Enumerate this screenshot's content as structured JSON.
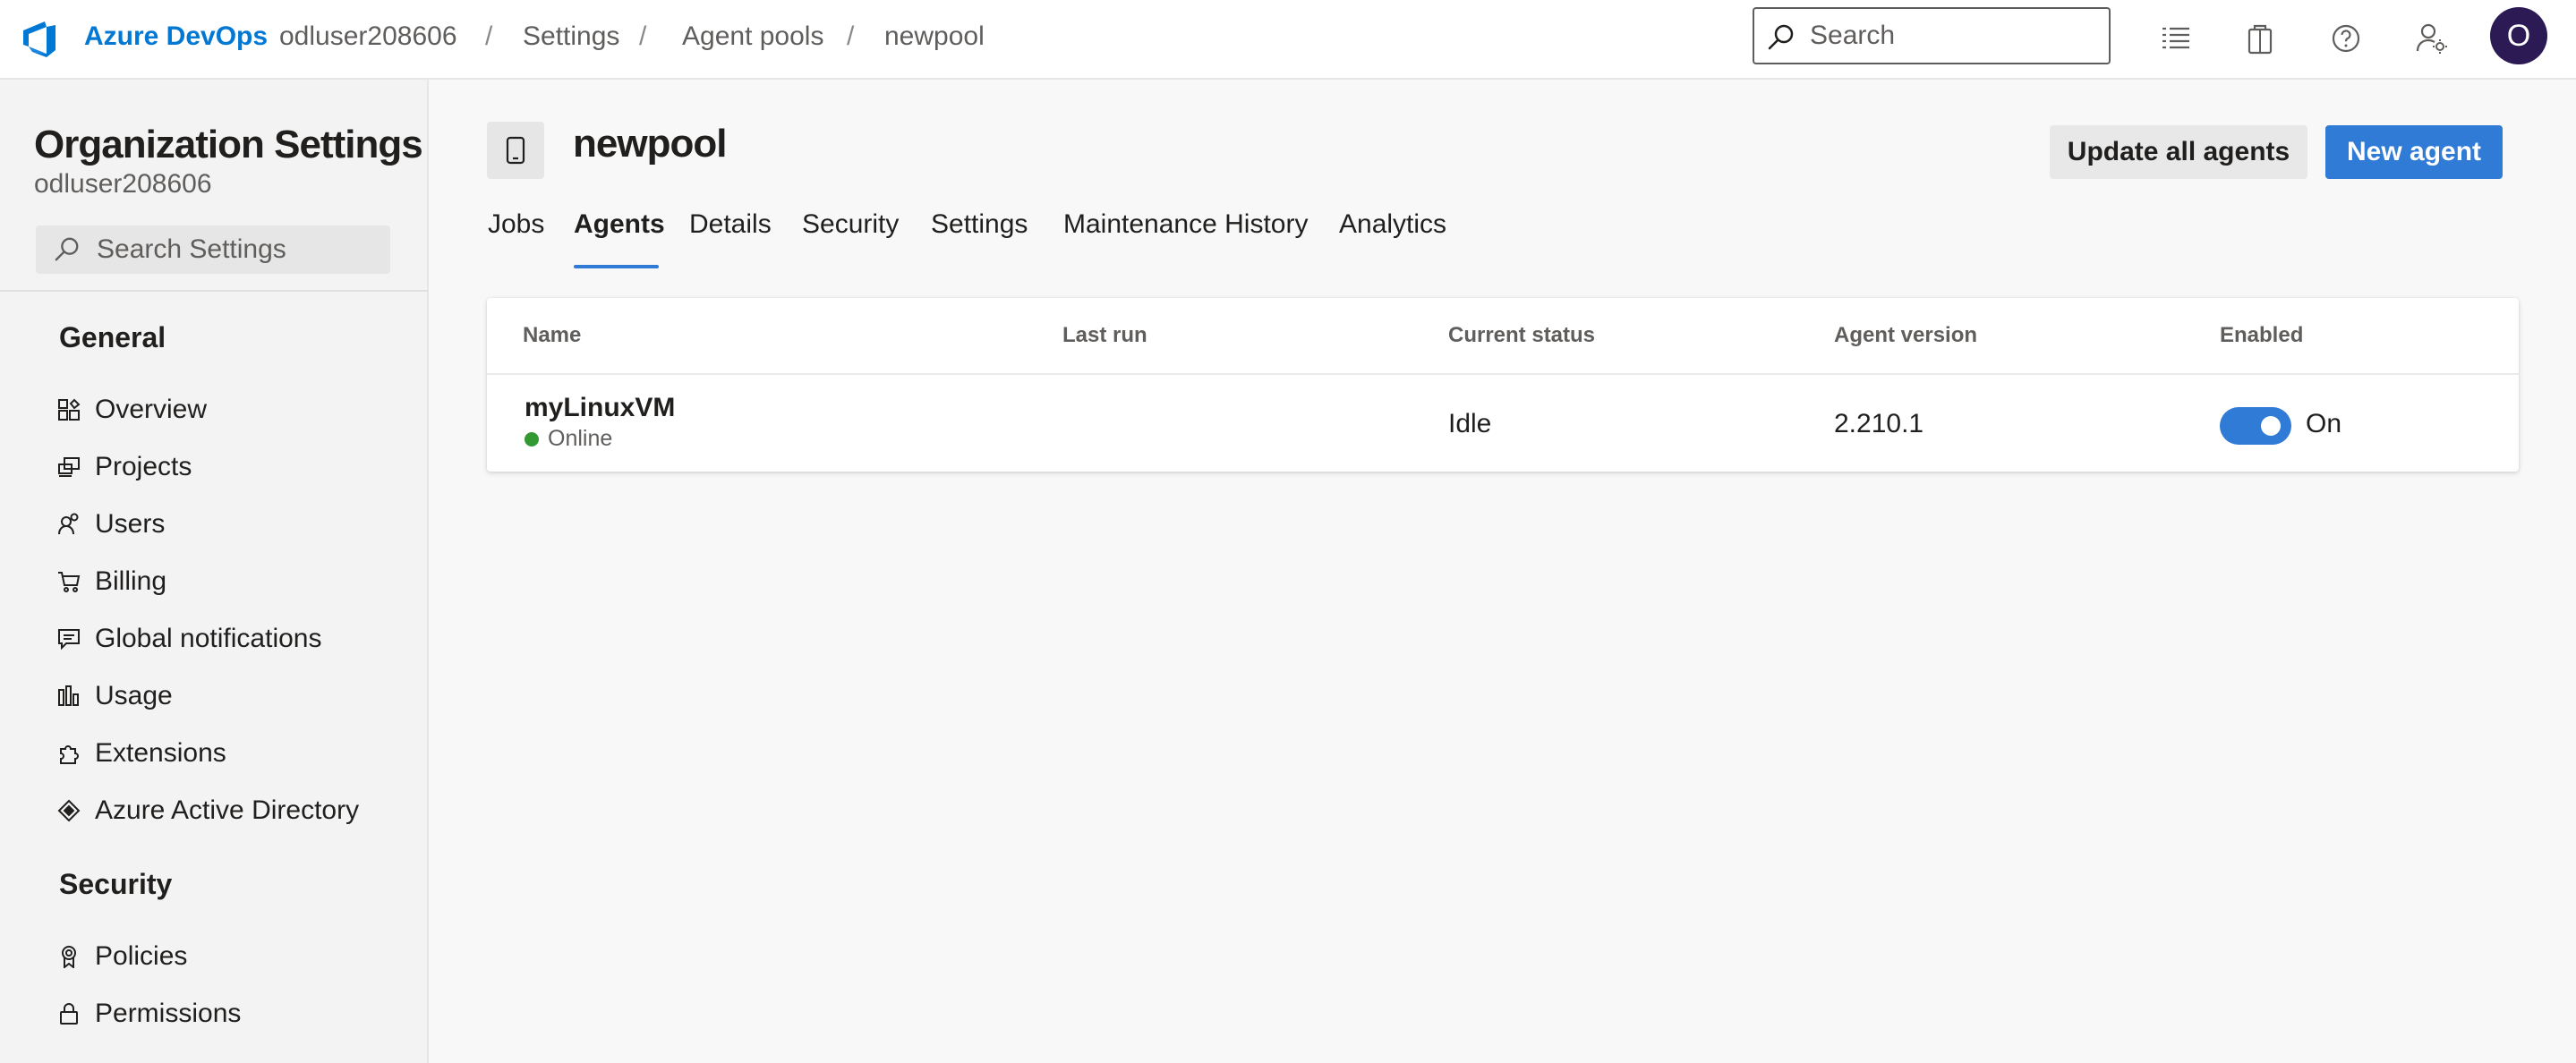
{
  "header": {
    "brand": "Azure DevOps",
    "breadcrumbs": [
      "odluser208606",
      "Settings",
      "Agent pools",
      "newpool"
    ],
    "search_placeholder": "Search",
    "avatar_initial": "O",
    "icons": [
      "task-list-icon",
      "marketplace-bag-icon",
      "help-icon",
      "user-settings-icon"
    ]
  },
  "sidebar": {
    "title": "Organization Settings",
    "subtitle": "odluser208606",
    "search_placeholder": "Search Settings",
    "sections": [
      {
        "title": "General",
        "items": [
          {
            "label": "Overview",
            "icon": "overview-icon"
          },
          {
            "label": "Projects",
            "icon": "projects-icon"
          },
          {
            "label": "Users",
            "icon": "users-icon"
          },
          {
            "label": "Billing",
            "icon": "cart-icon"
          },
          {
            "label": "Global notifications",
            "icon": "comment-icon"
          },
          {
            "label": "Usage",
            "icon": "bar-chart-icon"
          },
          {
            "label": "Extensions",
            "icon": "puzzle-icon"
          },
          {
            "label": "Azure Active Directory",
            "icon": "aad-diamond-icon"
          }
        ]
      },
      {
        "title": "Security",
        "items": [
          {
            "label": "Policies",
            "icon": "ribbon-icon"
          },
          {
            "label": "Permissions",
            "icon": "lock-icon"
          }
        ]
      }
    ]
  },
  "main": {
    "pool_name": "newpool",
    "buttons": {
      "update_all": "Update all agents",
      "new_agent": "New agent"
    },
    "tabs": [
      "Jobs",
      "Agents",
      "Details",
      "Security",
      "Settings",
      "Maintenance History",
      "Analytics"
    ],
    "active_tab": "Agents",
    "table": {
      "columns": [
        "Name",
        "Last run",
        "Current status",
        "Agent version",
        "Enabled"
      ],
      "rows": [
        {
          "name": "myLinuxVM",
          "online_status": "Online",
          "last_run": "",
          "current_status": "Idle",
          "agent_version": "2.210.1",
          "enabled_label": "On",
          "enabled": true
        }
      ]
    }
  },
  "colors": {
    "accent": "#2f7bd6",
    "brand": "#0078d4",
    "online": "#339933",
    "avatar_bg": "#2b1a53"
  }
}
